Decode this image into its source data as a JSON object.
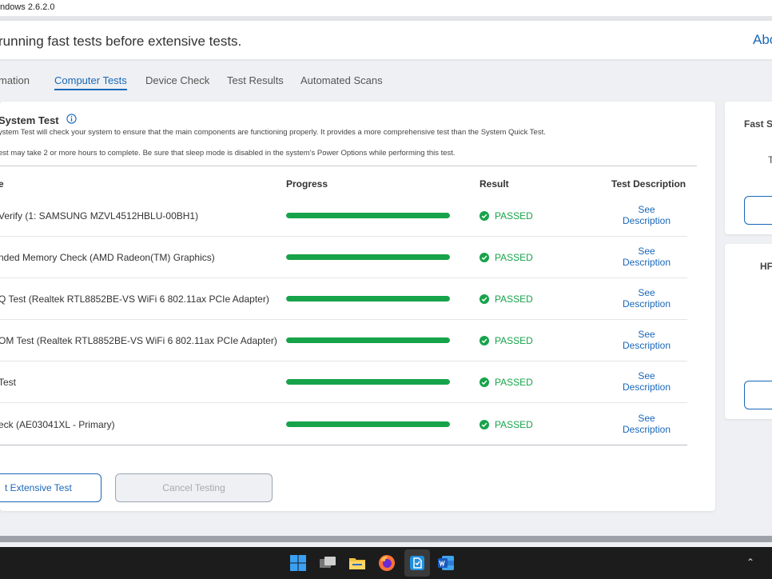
{
  "window": {
    "title": "ndows 2.6.2.0"
  },
  "header": {
    "title": "running fast tests before extensive tests.",
    "about": "Abo"
  },
  "tabs": [
    {
      "label": "mation",
      "active": false
    },
    {
      "label": "Computer Tests",
      "active": true
    },
    {
      "label": "Device Check",
      "active": false
    },
    {
      "label": "Test Results",
      "active": false
    },
    {
      "label": "Automated Scans",
      "active": false
    }
  ],
  "section": {
    "title": "System Test",
    "desc1": "ystem Test will check your system to ensure that the main components are functioning properly. It provides a more comprehensive test than the System Quick Test.",
    "desc2": "est may take 2 or more hours to complete. Be sure that sleep mode is disabled in the system's Power Options while performing this test."
  },
  "table": {
    "headers": {
      "name": "e",
      "progress": "Progress",
      "result": "Result",
      "description": "Test Description"
    },
    "rows": [
      {
        "name": "Verify (1: SAMSUNG MZVL4512HBLU-00BH1)",
        "progress": 100,
        "result": "PASSED",
        "desc_line1": "See",
        "desc_line2": "Description"
      },
      {
        "name": "nded Memory Check (AMD Radeon(TM) Graphics)",
        "progress": 100,
        "result": "PASSED",
        "desc_line1": "See",
        "desc_line2": "Description"
      },
      {
        "name": "Q Test (Realtek RTL8852BE-VS WiFi 6 802.11ax PCIe Adapter)",
        "progress": 100,
        "result": "PASSED",
        "desc_line1": "See",
        "desc_line2": "Description"
      },
      {
        "name": "OM Test (Realtek RTL8852BE-VS WiFi 6 802.11ax PCIe Adapter)",
        "progress": 100,
        "result": "PASSED",
        "desc_line1": "See",
        "desc_line2": "Description"
      },
      {
        "name": "Test",
        "progress": 100,
        "result": "PASSED",
        "desc_line1": "See",
        "desc_line2": "Description"
      },
      {
        "name": "eck (AE03041XL - Primary)",
        "progress": 100,
        "result": "PASSED",
        "desc_line1": "See",
        "desc_line2": "Description"
      }
    ]
  },
  "buttons": {
    "start": "t Extensive Test",
    "cancel": "Cancel Testing"
  },
  "side": {
    "card1_title": "Fast S",
    "card1_text": "T",
    "card2_title": "HF"
  },
  "colors": {
    "accent": "#1a67b8",
    "pass": "#16a34a"
  }
}
